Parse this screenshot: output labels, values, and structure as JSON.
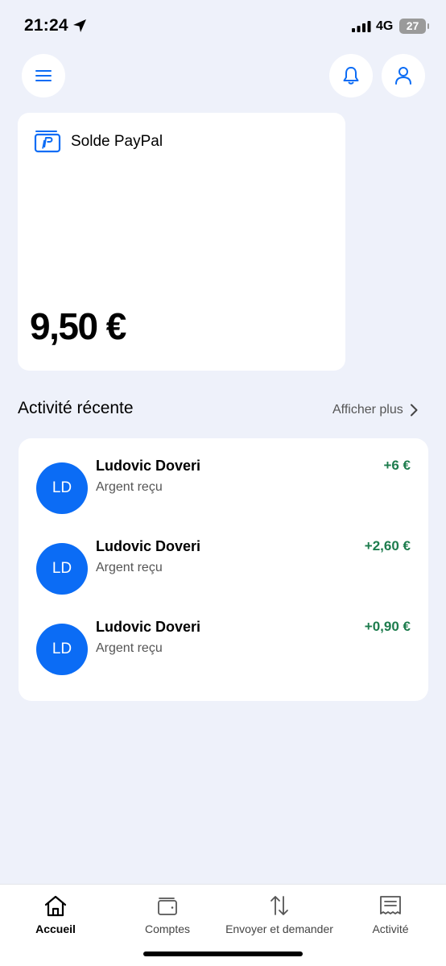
{
  "status_bar": {
    "time": "21:24",
    "network": "4G",
    "battery": "27"
  },
  "header": {
    "menu_icon": "hamburger-menu-icon",
    "notifications_icon": "bell-icon",
    "profile_icon": "user-icon"
  },
  "balance": {
    "label": "Solde PayPal",
    "amount": "9,50 €"
  },
  "activity": {
    "title": "Activité récente",
    "show_more": "Afficher plus",
    "transactions": [
      {
        "initials": "LD",
        "name": "Ludovic Doveri",
        "type": "Argent reçu",
        "amount": "+6 €"
      },
      {
        "initials": "LD",
        "name": "Ludovic Doveri",
        "type": "Argent reçu",
        "amount": "+2,60 €"
      },
      {
        "initials": "LD",
        "name": "Ludovic Doveri",
        "type": "Argent reçu",
        "amount": "+0,90 €"
      }
    ]
  },
  "bottom_nav": {
    "items": [
      {
        "label": "Accueil",
        "icon": "home-icon",
        "active": true
      },
      {
        "label": "Comptes",
        "icon": "wallet-icon",
        "active": false
      },
      {
        "label": "Envoyer et demander",
        "icon": "transfer-arrows-icon",
        "active": false
      },
      {
        "label": "Activité",
        "icon": "receipt-icon",
        "active": false
      }
    ]
  },
  "colors": {
    "background": "#eef1fa",
    "avatar": "#0b6cf5",
    "brand_blue": "#0b6cf5",
    "positive_amount": "#1d7c4d"
  }
}
